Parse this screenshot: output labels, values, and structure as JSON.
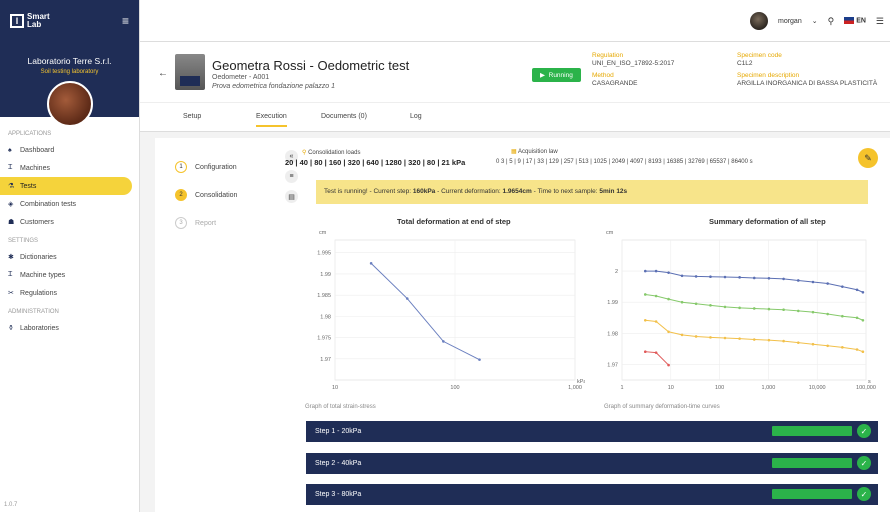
{
  "app": {
    "logo_text_1": "Smart",
    "logo_text_2": "Lab",
    "version": "1.0.7"
  },
  "lab": {
    "name": "Laboratorio Terre S.r.l.",
    "subtitle": "Soil testing laboratory"
  },
  "nav": {
    "applications_title": "APPLICATIONS",
    "applications": [
      {
        "label": "Dashboard",
        "icon": "home-icon"
      },
      {
        "label": "Machines",
        "icon": "machine-icon"
      },
      {
        "label": "Tests",
        "icon": "flask-icon",
        "active": true
      },
      {
        "label": "Combination tests",
        "icon": "layers-icon"
      },
      {
        "label": "Customers",
        "icon": "people-icon"
      }
    ],
    "settings_title": "SETTINGS",
    "settings": [
      {
        "label": "Dictionaries",
        "icon": "gear-icon"
      },
      {
        "label": "Machine types",
        "icon": "machine-icon"
      },
      {
        "label": "Regulations",
        "icon": "tools-icon"
      }
    ],
    "administration_title": "ADMINISTRATION",
    "administration": [
      {
        "label": "Laboratories",
        "icon": "flask-icon"
      }
    ]
  },
  "topbar": {
    "username": "morgan",
    "language": "EN"
  },
  "header": {
    "title": "Geometra Rossi - Oedometric test",
    "machine": "Oedometer - A001",
    "description": "Prova edometrica fondazione palazzo 1",
    "status": "Running",
    "regulation_label": "Regulation",
    "regulation": "UNI_EN_ISO_17892-5:2017",
    "method_label": "Method",
    "method": "CASAGRANDE",
    "specimen_code_label": "Specimen code",
    "specimen_code": "C1L2",
    "specimen_desc_label": "Specimen description",
    "specimen_desc": "ARGILLA INORGANICA DI BASSA PLASTICITÀ"
  },
  "tabs": [
    "Setup",
    "Execution",
    "Documents (0)",
    "Log"
  ],
  "steps": [
    "Configuration",
    "Consolidation",
    "Report"
  ],
  "loads": {
    "label": "Consolidation loads",
    "value": "20 | 40 | 80 | 160 | 320 | 640 | 1280 | 320 | 80 | 21 kPa"
  },
  "law": {
    "label": "Acquisition law",
    "value": "0 3 | 5 | 9 | 17 | 33 | 129 | 257 | 513 | 1025 | 2049 | 4097 | 8193 | 16385 | 32769 | 65537 | 86400 s"
  },
  "banner": {
    "prefix": "Test is running! - Current step: ",
    "step": "160kPa",
    "mid": " - Current deformation: ",
    "deformation": "1.9654cm",
    "mid2": " - Time to next sample: ",
    "time": "5min 12s"
  },
  "chart_data": [
    {
      "type": "line",
      "title": "Total deformation at end of step",
      "ylabel": "cm",
      "xlabel": "kPa",
      "xscale": "log",
      "xlim": [
        10,
        1000
      ],
      "ylim": [
        1.965,
        1.998
      ],
      "xticks": [
        "10",
        "100",
        "1,000"
      ],
      "yticks": [
        "1.97",
        "1.975",
        "1.98",
        "1.985",
        "1.99",
        "1.995"
      ],
      "caption": "Graph of total strain-stress",
      "series": [
        {
          "color": "#6a7fbf",
          "x": [
            20,
            40,
            80,
            160
          ],
          "y": [
            1.9925,
            1.9842,
            1.9741,
            1.9698
          ]
        }
      ]
    },
    {
      "type": "line",
      "title": "Summary deformation of all step",
      "ylabel": "cm",
      "xlabel": "s",
      "xscale": "log",
      "xlim": [
        1,
        100000
      ],
      "ylim": [
        1.965,
        2.01
      ],
      "xticks": [
        "1",
        "10",
        "100",
        "1,000",
        "10,000",
        "100,000"
      ],
      "yticks": [
        "1.97",
        "1.98",
        "1.99",
        "2"
      ],
      "caption": "Graph of summary deformation-time curves",
      "series": [
        {
          "color": "#5b6fb3",
          "x": [
            3,
            5,
            9,
            17,
            33,
            65,
            129,
            257,
            513,
            1025,
            2049,
            4097,
            8193,
            16385,
            32769,
            65537,
            86400
          ],
          "y": [
            2.0,
            2.0,
            1.9995,
            1.9985,
            1.9983,
            1.9982,
            1.9981,
            1.998,
            1.9978,
            1.9977,
            1.9975,
            1.997,
            1.9965,
            1.996,
            1.995,
            1.994,
            1.9932
          ]
        },
        {
          "color": "#86c96b",
          "x": [
            3,
            5,
            9,
            17,
            33,
            65,
            129,
            257,
            513,
            1025,
            2049,
            4097,
            8193,
            16385,
            32769,
            65537,
            86400
          ],
          "y": [
            1.9925,
            1.992,
            1.991,
            1.99,
            1.9895,
            1.989,
            1.9885,
            1.9882,
            1.988,
            1.9878,
            1.9876,
            1.9872,
            1.9868,
            1.9862,
            1.9855,
            1.985,
            1.9842
          ]
        },
        {
          "color": "#f2c04a",
          "x": [
            3,
            5,
            9,
            17,
            33,
            65,
            129,
            257,
            513,
            1025,
            2049,
            4097,
            8193,
            16385,
            32769,
            65537,
            86400
          ],
          "y": [
            1.9842,
            1.9838,
            1.9805,
            1.9795,
            1.979,
            1.9787,
            1.9785,
            1.9783,
            1.978,
            1.9778,
            1.9775,
            1.977,
            1.9765,
            1.976,
            1.9755,
            1.9748,
            1.9741
          ]
        },
        {
          "color": "#e05a5a",
          "x": [
            3,
            5,
            9
          ],
          "y": [
            1.9741,
            1.9738,
            1.9698
          ]
        }
      ]
    }
  ],
  "step_bars": [
    "Step 1 - 20kPa",
    "Step 2 - 40kPa",
    "Step 3 - 80kPa"
  ]
}
